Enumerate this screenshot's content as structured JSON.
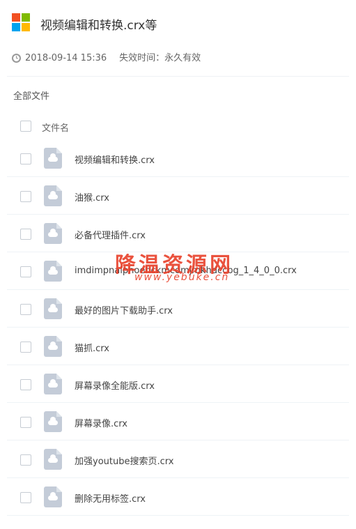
{
  "header": {
    "title": "视频编辑和转换.crx等",
    "date": "2018-09-14 15:36",
    "expiry": "失效时间：永久有效",
    "logo_colors": [
      "#f25022",
      "#7fba00",
      "#00a4ef",
      "#ffb900"
    ]
  },
  "breadcrumb": "全部文件",
  "table": {
    "column_header": "文件名",
    "files": [
      {
        "name": "视频编辑和转换.crx",
        "icon": "cloud-file-icon"
      },
      {
        "name": "油猴.crx",
        "icon": "cloud-file-icon"
      },
      {
        "name": "必备代理插件.crx",
        "icon": "cloud-file-icon"
      },
      {
        "name": "imdimpnalpnoehckmcomjmkhdccbg_1_4_0_0.crx",
        "icon": "cloud-file-icon"
      },
      {
        "name": "最好的图片下载助手.crx",
        "icon": "cloud-file-icon"
      },
      {
        "name": "猫抓.crx",
        "icon": "cloud-file-icon"
      },
      {
        "name": "屏幕录像全能版.crx",
        "icon": "cloud-file-icon"
      },
      {
        "name": "屏幕录像.crx",
        "icon": "cloud-file-icon"
      },
      {
        "name": "加强youtube搜索页.crx",
        "icon": "cloud-file-icon"
      },
      {
        "name": "删除无用标签.crx",
        "icon": "cloud-file-icon"
      }
    ]
  },
  "watermark": {
    "text": "降温资源网",
    "url": "www.yebuke.cn",
    "color": "#e8402a"
  }
}
